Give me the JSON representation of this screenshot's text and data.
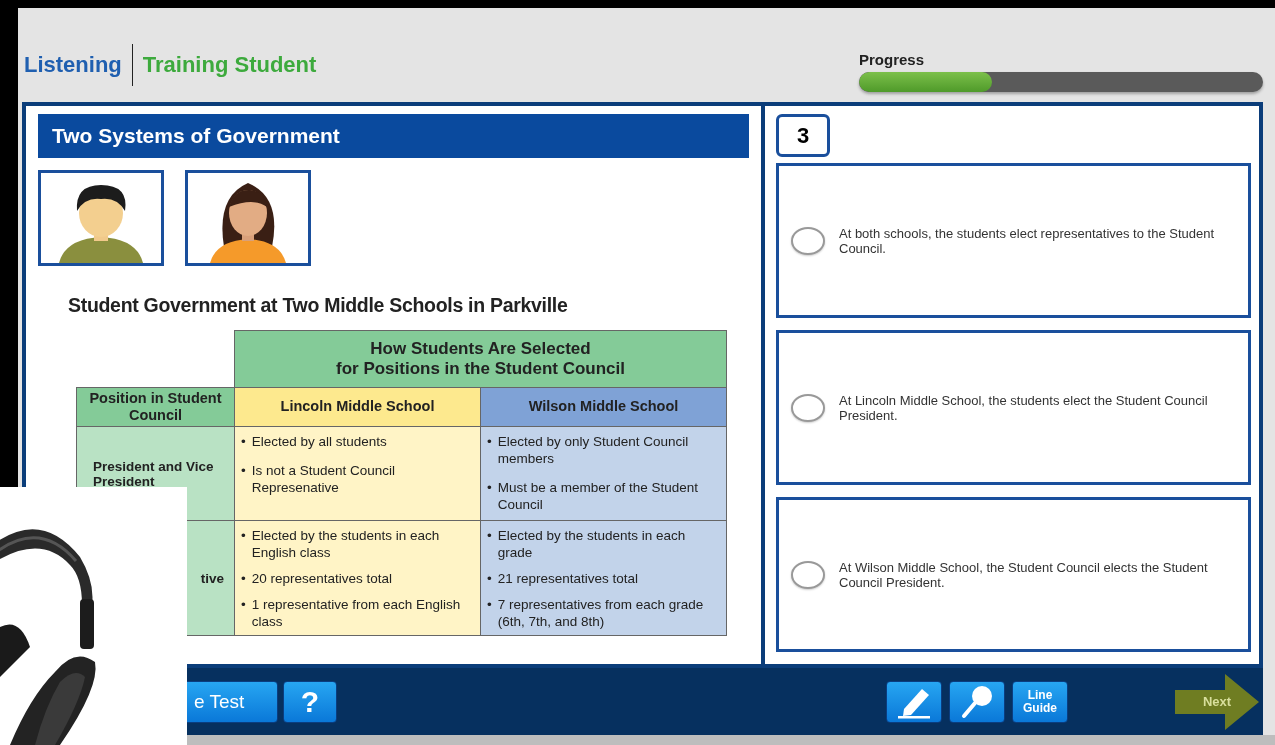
{
  "header": {
    "section": "Listening",
    "student": "Training Student",
    "progress": {
      "label": "Progress",
      "level": 0.33
    }
  },
  "passage": {
    "title": "Two Systems of Government",
    "avatars": [
      {
        "kind": "boy"
      },
      {
        "kind": "girl"
      }
    ],
    "table": {
      "title": "Student Government at Two Middle Schools in Parkville",
      "group_heading": "How Students Are Selected\nfor Positions in the Student Council",
      "bullet": "•",
      "columns": [
        "Position in Student Council",
        "Lincoln Middle School",
        "Wilson Middle School"
      ],
      "rows": [
        {
          "cells": [
            [
              "President and Vice President"
            ],
            [
              "Elected by all students",
              "Is not a Student Council Represenative"
            ],
            [
              "Elected by only Student Council members",
              "Must be a member of the Student Council"
            ]
          ]
        },
        {
          "cells": [
            [
              "tive"
            ],
            [
              "Elected by the students in each English class",
              "20 representatives total",
              "1 representative from each English class"
            ],
            [
              "Elected by the students in each grade",
              "21 representatives total",
              "7 representatives from each grade (6th, 7th, and 8th)"
            ]
          ]
        }
      ]
    }
  },
  "question": {
    "number": "3",
    "options": [
      {
        "text": "At both schools, the students elect representatives to the Student Council.",
        "selected": false
      },
      {
        "text": "At Lincoln Middle School, the students elect the Student Council President.",
        "selected": false
      },
      {
        "text": "At Wilson Middle School, the Student Council elects the Student Council President.",
        "selected": false
      }
    ]
  },
  "toolbar": {
    "left_buttons": [
      {
        "kind": "text",
        "label": "e Test"
      },
      {
        "kind": "help",
        "label": "?"
      }
    ],
    "tools": [
      {
        "kind": "highlighter"
      },
      {
        "kind": "magnifier"
      },
      {
        "kind": "text",
        "label": "Line Guide"
      }
    ],
    "next": {
      "label": "Next",
      "disabled": true
    }
  }
}
